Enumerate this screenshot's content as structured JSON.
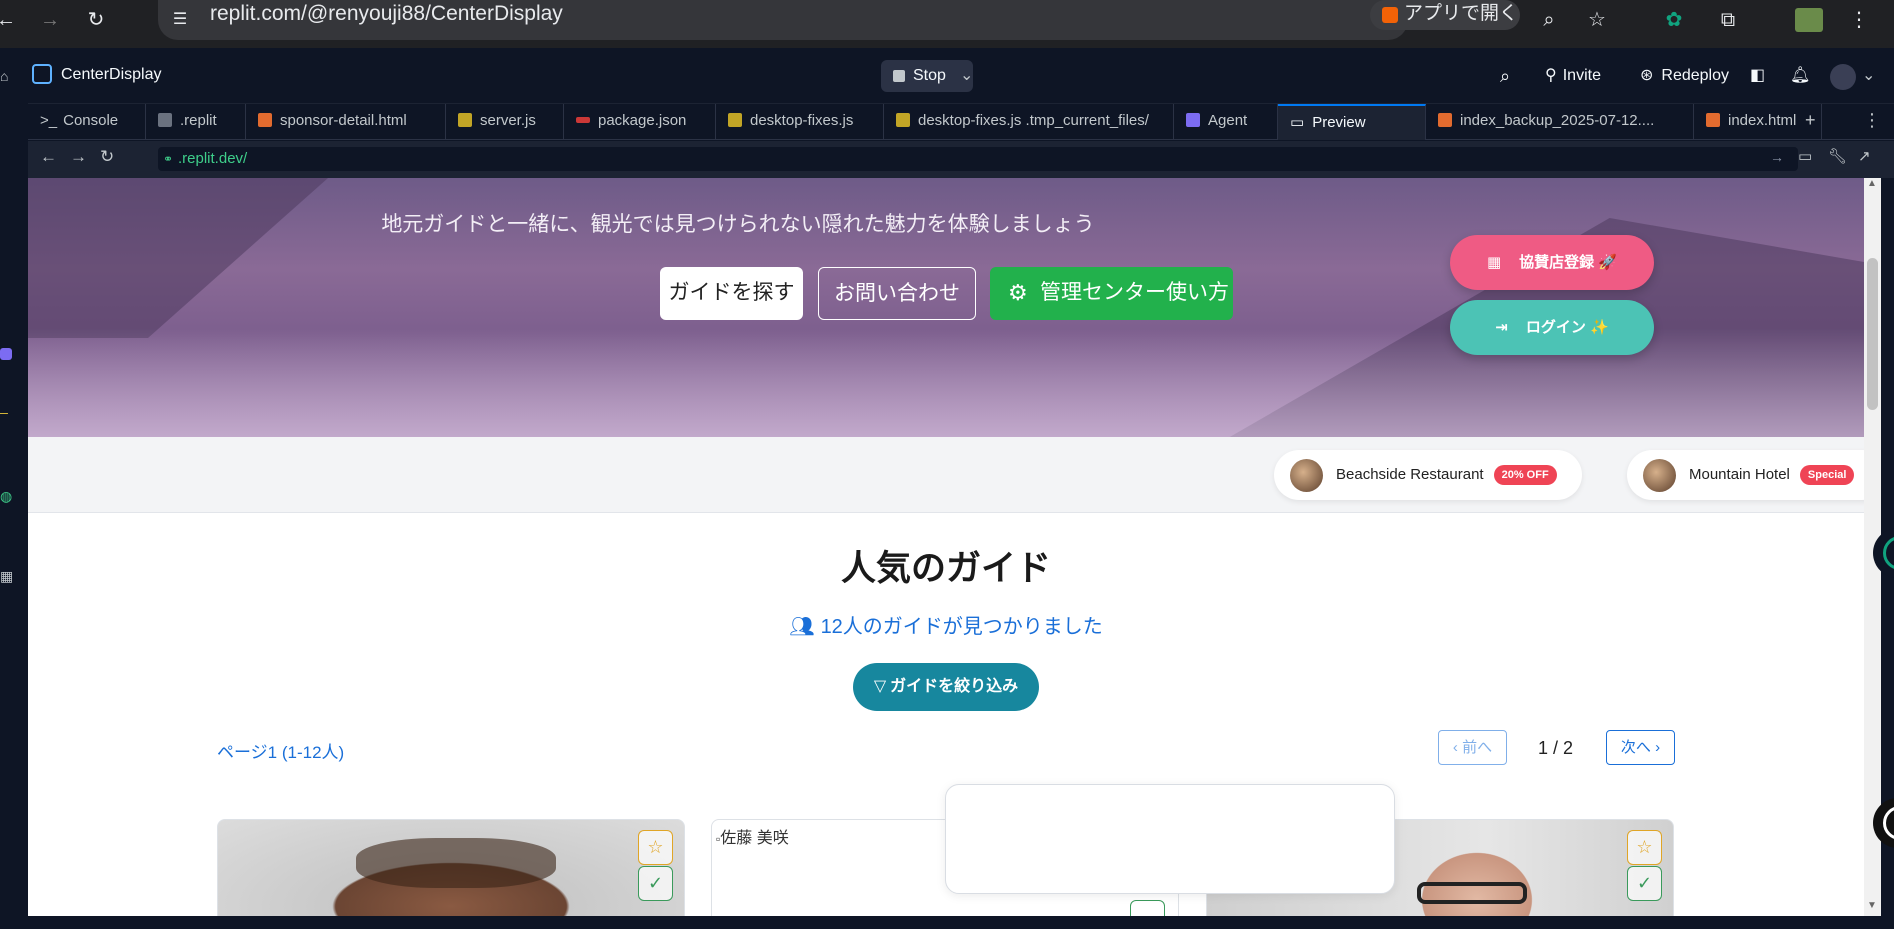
{
  "browser": {
    "url": "replit.com/@renyouji88/CenterDisplay",
    "open_app_label": "アプリで開く"
  },
  "topbar": {
    "project_name": "CenterDisplay",
    "stop_label": "Stop",
    "invite_label": "Invite",
    "redeploy_label": "Redeploy"
  },
  "tabs": [
    {
      "label": "Console"
    },
    {
      "label": ".replit"
    },
    {
      "label": "sponsor-detail.html"
    },
    {
      "label": "server.js"
    },
    {
      "label": "package.json"
    },
    {
      "label": "desktop-fixes.js"
    },
    {
      "label": "desktop-fixes.js .tmp_current_files/"
    },
    {
      "label": "Agent"
    },
    {
      "label": "Preview"
    },
    {
      "label": "index_backup_2025-07-12...."
    },
    {
      "label": "index.html"
    }
  ],
  "preview": {
    "url": ".replit.dev/"
  },
  "hero": {
    "subtitle": "地元ガイドと一緒に、観光では見つけられない隠れた魅力を体験しましょう",
    "find_guide_label": "ガイドを探す",
    "contact_label": "お問い合わせ",
    "admin_label": "管理センター使い方",
    "sponsor_register_label": "協賛店登録",
    "sponsor_register_emoji": "🚀",
    "login_label": "ログイン",
    "login_emoji": "✨"
  },
  "sponsors": [
    {
      "name": "Beachside Restaurant",
      "badge": "20% OFF"
    },
    {
      "name": "Mountain Hotel",
      "badge": "Special"
    }
  ],
  "guides_section": {
    "title": "人気のガイド",
    "found_text": "12人のガイドが見つかりました",
    "filter_label": "ガイドを絞り込み",
    "page_info": "ページ1 (1-12人)",
    "prev_label": "前へ",
    "next_label": "次へ",
    "page_counter": "1 / 2"
  },
  "cards": [
    {
      "alt": ""
    },
    {
      "alt": "佐藤 美咲"
    },
    {
      "alt": ""
    }
  ],
  "colors": {
    "accent_blue": "#1a6fd8",
    "admin_green": "#22b14c",
    "sponsor_pink": "#ef5b84",
    "login_teal": "#4cc3b5",
    "filter_teal": "#17879e"
  }
}
